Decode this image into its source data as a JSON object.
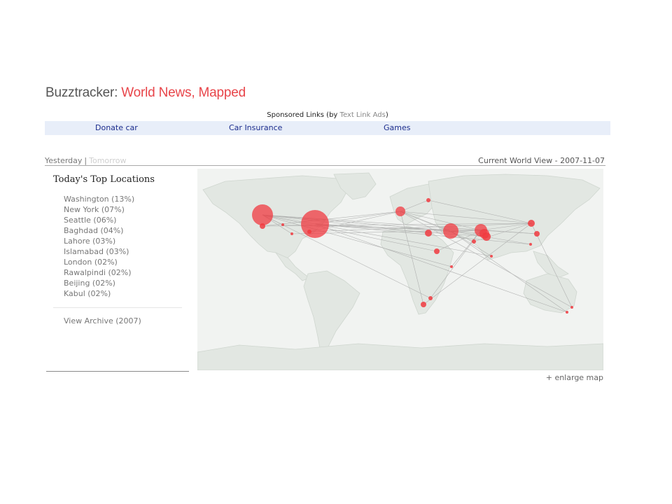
{
  "site": {
    "brand": "Buzztracker:",
    "tagline": " World News, Mapped"
  },
  "sponsored": {
    "prefix": "Sponsored Links (by ",
    "provider": "Text Link Ads",
    "suffix": ")",
    "links": [
      "Donate car",
      "Car Insurance",
      "Games"
    ]
  },
  "nav": {
    "yesterday": "Yesterday",
    "separator": "|",
    "tomorrow": "Tomorrow",
    "current_view": "Current World View - 2007-11-07"
  },
  "sidebar": {
    "title": "Today's Top Locations",
    "locations": [
      {
        "label": "Washington (13%)",
        "share": 13
      },
      {
        "label": "New York (07%)",
        "share": 7
      },
      {
        "label": "Seattle (06%)",
        "share": 6
      },
      {
        "label": "Baghdad (04%)",
        "share": 4
      },
      {
        "label": "Lahore (03%)",
        "share": 3
      },
      {
        "label": "Islamabad (03%)",
        "share": 3
      },
      {
        "label": "London (02%)",
        "share": 2
      },
      {
        "label": "Rawalpindi (02%)",
        "share": 2
      },
      {
        "label": "Beijing (02%)",
        "share": 2
      },
      {
        "label": "Kabul (02%)",
        "share": 2
      }
    ],
    "archive_link": "View Archive (2007)"
  },
  "map": {
    "enlarge_label": "+ enlarge map",
    "land_color": "#e2e7e2",
    "ocean_color": "#f1f3f1",
    "hotspot_color": "#f03a40"
  }
}
